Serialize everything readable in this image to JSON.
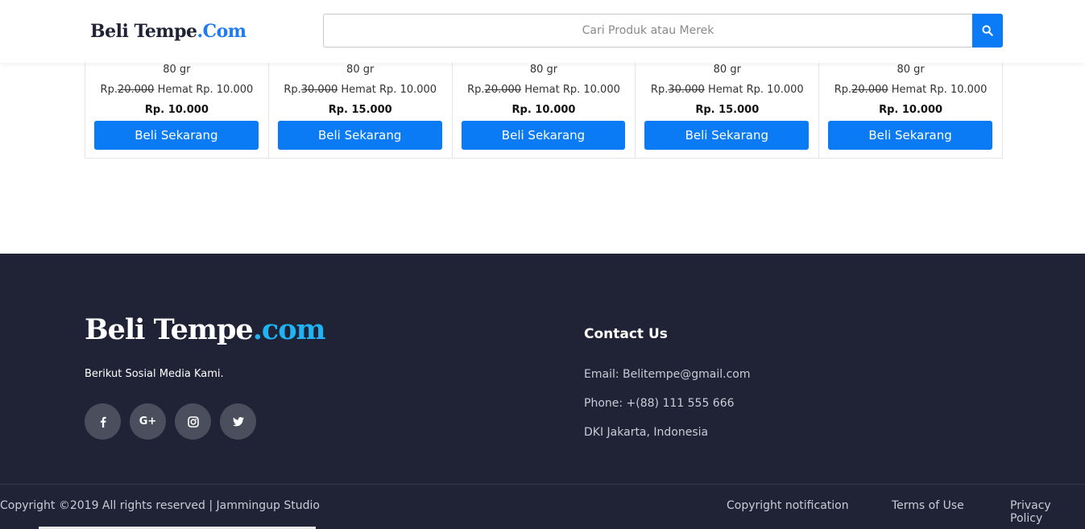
{
  "header": {
    "brand_main": "Beli Tempe",
    "brand_accent": ".Com",
    "search_placeholder": "Cari Produk atau Merek",
    "search_icon": "search-icon"
  },
  "products": [
    {
      "weight": "80 gr",
      "price_prefix": "Rp.",
      "original": "20.000",
      "saving": "Hemat Rp. 10.000",
      "final": "Rp. 10.000",
      "button": "Beli Sekarang"
    },
    {
      "weight": "80 gr",
      "price_prefix": "Rp.",
      "original": "30.000",
      "saving": "Hemat Rp. 10.000",
      "final": "Rp. 15.000",
      "button": "Beli Sekarang"
    },
    {
      "weight": "80 gr",
      "price_prefix": "Rp.",
      "original": "20.000",
      "saving": "Hemat Rp. 10.000",
      "final": "Rp. 10.000",
      "button": "Beli Sekarang"
    },
    {
      "weight": "80 gr",
      "price_prefix": "Rp.",
      "original": "30.000",
      "saving": "Hemat Rp. 10.000",
      "final": "Rp. 15.000",
      "button": "Beli Sekarang"
    },
    {
      "weight": "80 gr",
      "price_prefix": "Rp.",
      "original": "20.000",
      "saving": "Hemat Rp. 10.000",
      "final": "Rp. 10.000",
      "button": "Beli Sekarang"
    }
  ],
  "footer": {
    "brand_main": "Beli Tempe",
    "brand_accent": ".com",
    "tagline": "Berikut Sosial Media Kami.",
    "socials": [
      {
        "icon": "facebook-icon",
        "glyph": "f"
      },
      {
        "icon": "google-plus-icon",
        "glyph": "G+"
      },
      {
        "icon": "instagram-icon",
        "glyph": ""
      },
      {
        "icon": "twitter-icon",
        "glyph": ""
      }
    ],
    "contact_title": "Contact Us",
    "email": "Email: Belitempe@gmail.com",
    "phone": "Phone: +(88) 111 555 666",
    "address": "DKI Jakarta, Indonesia",
    "copyright": "Copyright ©2019 All rights reserved | Jammingup Studio",
    "links": [
      "Copyright notification",
      "Terms of Use",
      "Privacy Policy"
    ]
  },
  "colors": {
    "primary": "#0a7bf5",
    "footer_bg": "#1f2335",
    "brand_accent_header": "#1e7bf0",
    "brand_accent_footer": "#1fb3f3"
  }
}
